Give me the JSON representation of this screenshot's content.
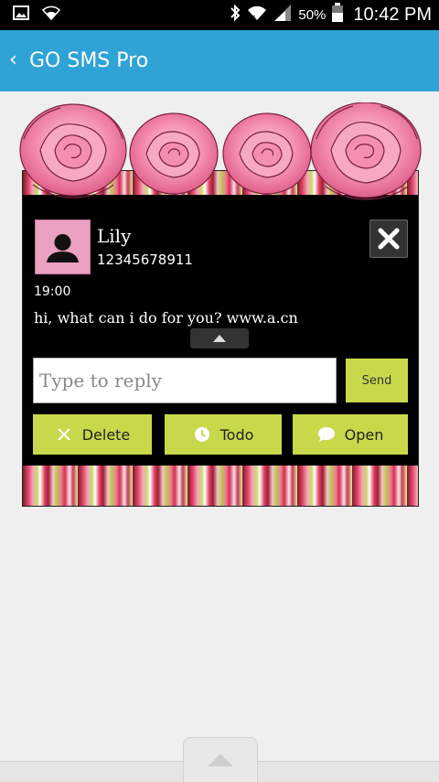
{
  "status_bar": {
    "battery": "50%",
    "time": "10:42 PM",
    "icons": [
      "image-icon",
      "wifi-icon",
      "bluetooth-icon",
      "wifi-icon",
      "signal-icon",
      "battery-icon"
    ]
  },
  "app_bar": {
    "back_glyph": "‹",
    "title": "GO SMS Pro"
  },
  "popup": {
    "contact": {
      "name": "Lily",
      "number": "12345678911",
      "avatar_icon": "person-silhouette-icon"
    },
    "close_icon": "close-icon",
    "message": {
      "time": "19:00",
      "text": "hi, what can i do for you? www.a.cn"
    },
    "expand_icon": "chevron-up-icon",
    "reply": {
      "placeholder": "Type to reply",
      "value": ""
    },
    "send_label": "Send",
    "actions": {
      "delete_label": "Delete",
      "todo_label": "Todo",
      "open_label": "Open"
    }
  },
  "bottom": {
    "pull_icon": "chevron-up-icon"
  },
  "colors": {
    "app_bar": "#2fa3d6",
    "button": "#c9d84a",
    "popup_bg": "#000000",
    "avatar_bg": "#eaa0c0",
    "rose": "#f48fb1"
  }
}
